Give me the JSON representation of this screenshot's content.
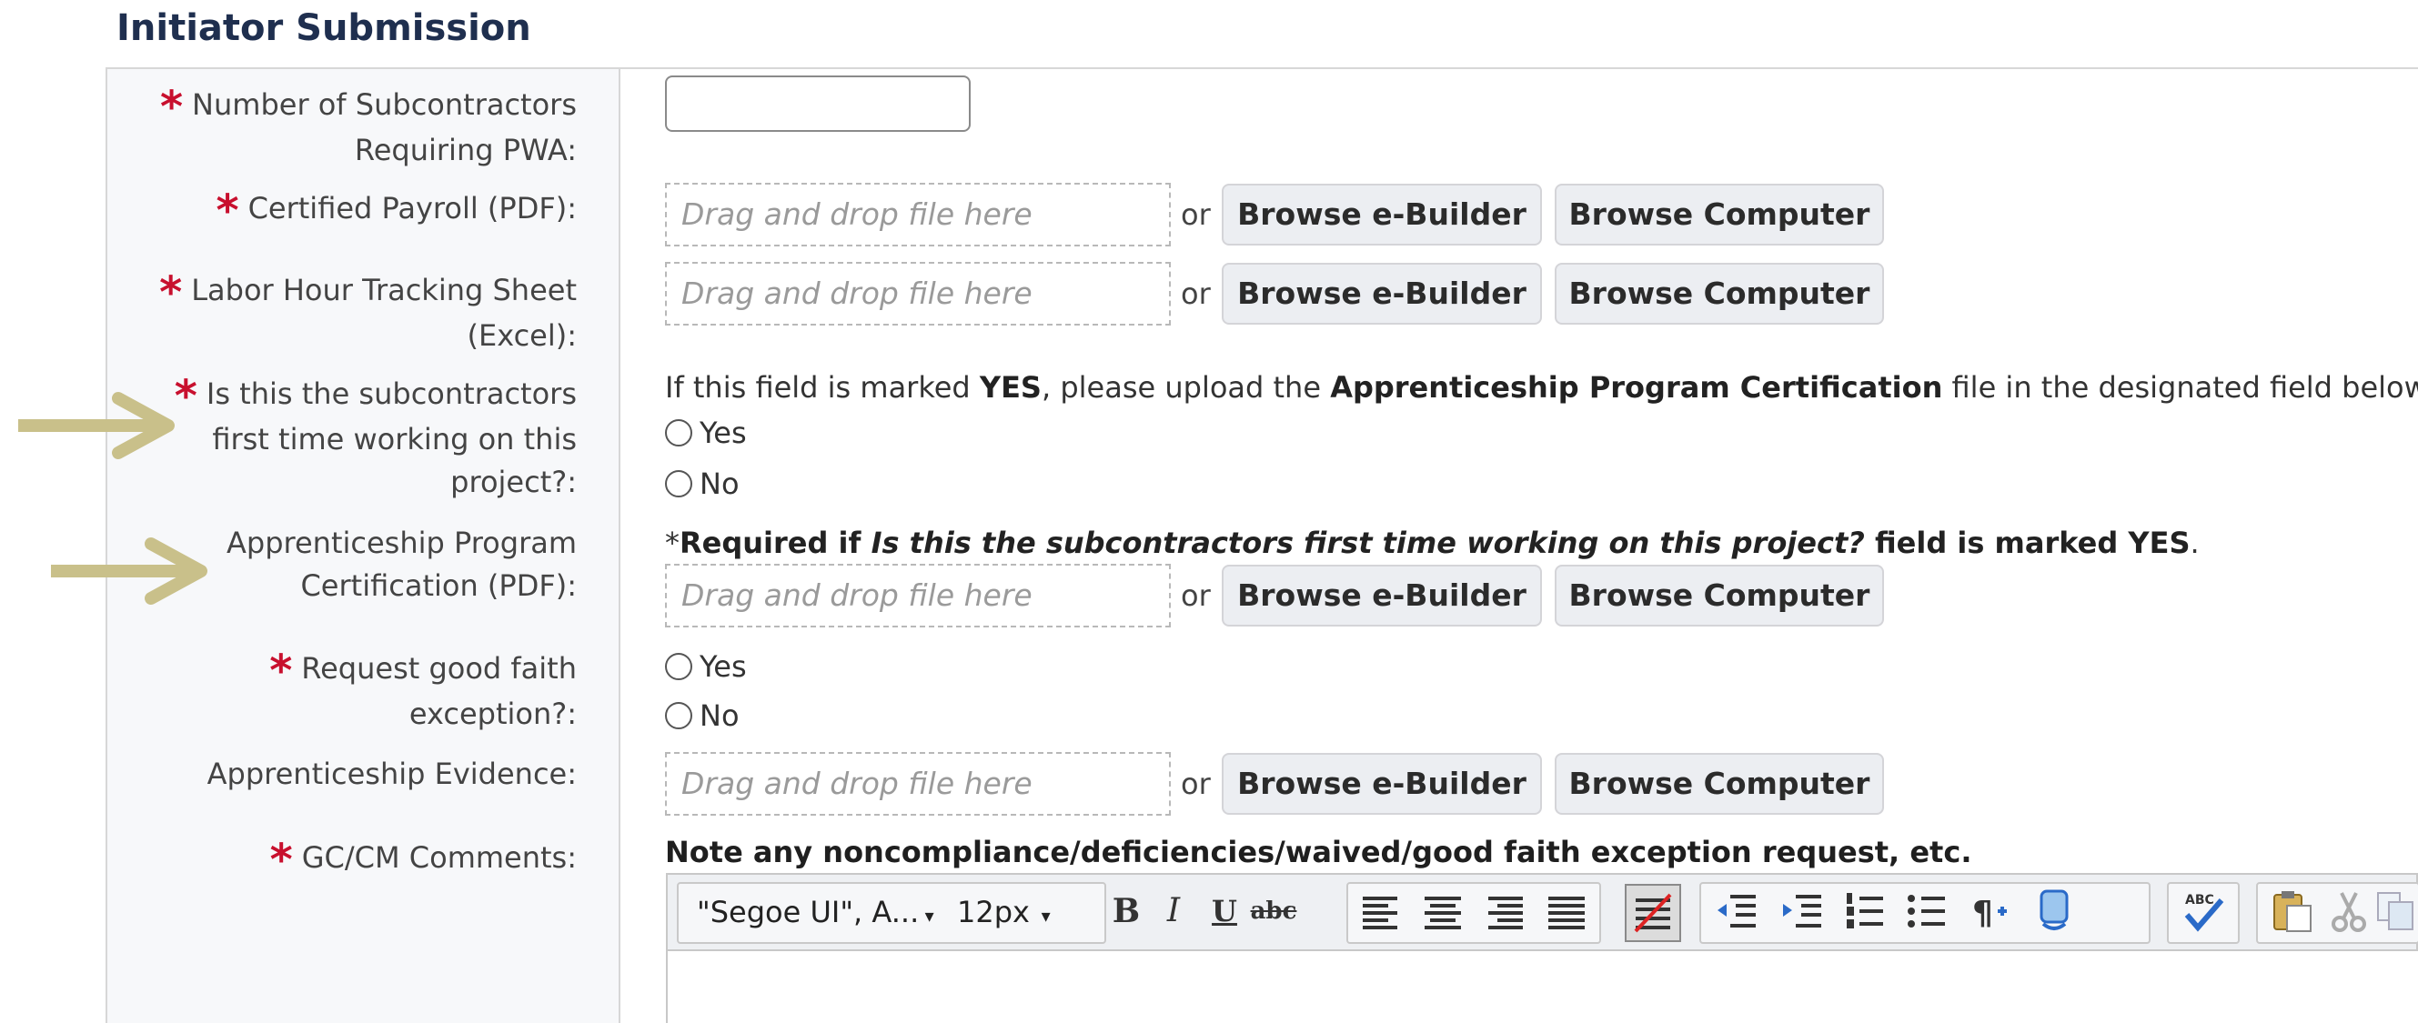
{
  "section": {
    "title": "Initiator Submission"
  },
  "fields": {
    "num_subcontractors": {
      "label_line1": "Number of Subcontractors",
      "label_line2": "Requiring PWA:",
      "value": ""
    },
    "certified_payroll": {
      "label": "Certified Payroll (PDF):"
    },
    "labor_hour": {
      "label_line1": "Labor Hour Tracking Sheet",
      "label_line2": "(Excel):"
    },
    "first_time": {
      "label_line1": "Is this the subcontractors",
      "label_line2": "first time working on this",
      "label_line3": "project?:"
    },
    "apprenticeship_cert": {
      "label_line1": "Apprenticeship Program",
      "label_line2": "Certification (PDF):"
    },
    "good_faith": {
      "label_line1": "Request good faith",
      "label_line2": "exception?:"
    },
    "apprenticeship_evidence": {
      "label": "Apprenticeship Evidence:"
    },
    "gc_comments": {
      "label": "GC/CM Comments:"
    }
  },
  "common": {
    "required_mark": "*",
    "drop_placeholder": "Drag and drop file here",
    "or_text": "or",
    "browse_ebuilder": "Browse e-Builder",
    "browse_computer": "Browse Computer",
    "yes": "Yes",
    "no": "No"
  },
  "first_time_info": {
    "pre": "If this field is marked ",
    "yes_bold": "YES",
    "mid": ", please upload the ",
    "doc_bold": "Apprenticeship Program Certification",
    "post": " file in the designated field below."
  },
  "cert_note": {
    "star": "*",
    "required_if": "Required if ",
    "question_italic": "Is this the subcontractors first time working on this project?",
    "marked": " field is marked YES",
    "period": "."
  },
  "comments_note": "Note any noncompliance/deficiencies/waived/good faith exception request, etc.",
  "editor": {
    "font_family": "\"Segoe UI\", A...",
    "font_size": "12px",
    "bold": "B",
    "italic": "I",
    "underline": "U",
    "strike": "abc"
  },
  "colors": {
    "required": "#c8102e",
    "arrow": "#c9c08a",
    "label_bg": "#f7f8fa",
    "button_bg": "#eceef2",
    "title": "#1f2f4f"
  }
}
